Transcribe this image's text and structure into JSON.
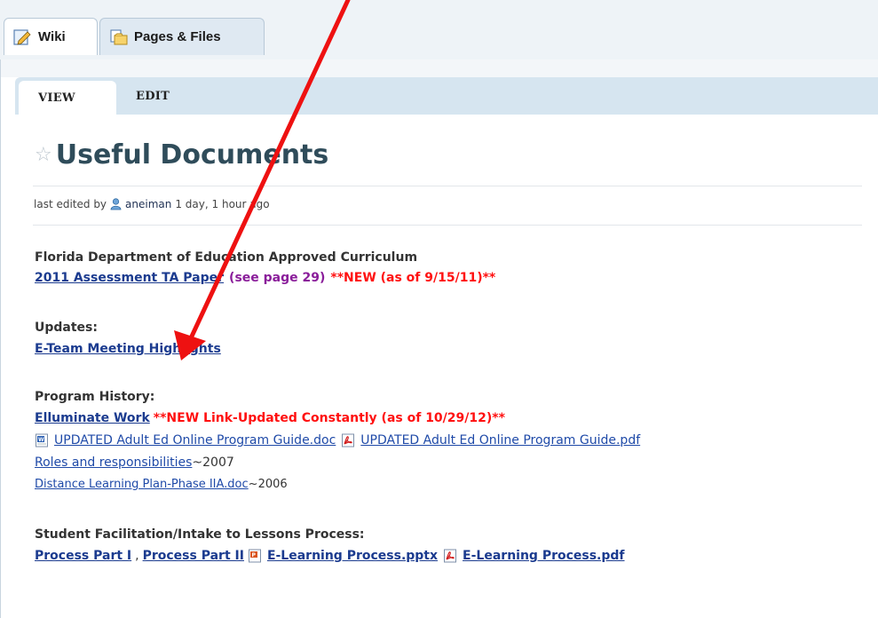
{
  "tabs": {
    "wiki": "Wiki",
    "pages_files": "Pages & Files"
  },
  "subtabs": {
    "view": "VIEW",
    "edit": "EDIT"
  },
  "page": {
    "title": "Useful Documents",
    "meta_prefix": "last edited by",
    "editor": "aneiman",
    "meta_time": "1 day, 1 hour ago"
  },
  "sections": {
    "curriculum": {
      "heading": "Florida Department of Education Approved Curriculum",
      "link": "2011 Assessment TA Paper",
      "note": "(see page 29)",
      "new": "**NEW (as of 9/15/11)**"
    },
    "updates": {
      "heading": "Updates:",
      "link": "E-Team Meeting Highlights"
    },
    "history": {
      "heading": "Program History:",
      "elluminate_link": "Elluminate Work",
      "elluminate_new": "**NEW Link-Updated Constantly (as of 10/29/12)**",
      "guide_doc": "UPDATED Adult Ed Online Program Guide.doc",
      "guide_pdf": "UPDATED Adult Ed Online Program Guide.pdf",
      "roles_link": "Roles and responsibilities",
      "roles_year": "~2007",
      "dl_link": "Distance Learning Plan-Phase IIA.doc",
      "dl_year": "~2006"
    },
    "facilitation": {
      "heading": "Student Facilitation/Intake to Lessons Process:",
      "part1": "Process Part I",
      "part2": "Process Part II",
      "pptx": "E-Learning Process.pptx",
      "pdf": "E-Learning Process.pdf"
    }
  },
  "colors": {
    "accent_red": "#ff1010",
    "link_blue": "#1f4aa8",
    "title": "#2f4c5a"
  }
}
